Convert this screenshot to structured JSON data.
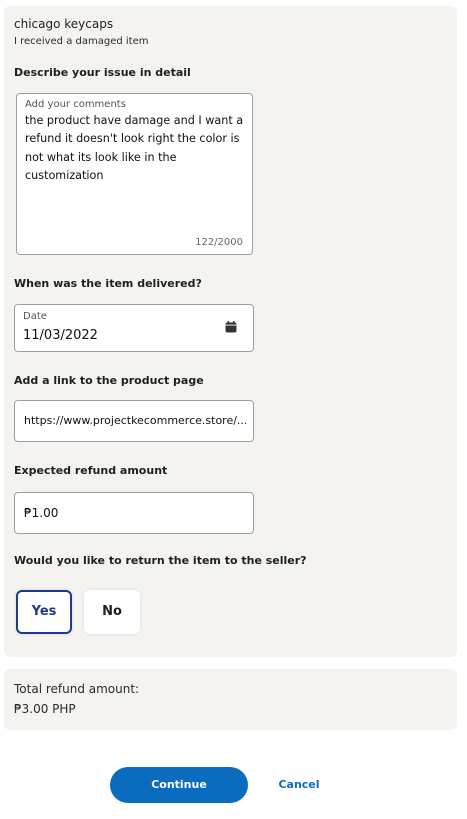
{
  "header": {
    "merchant": "chicago keycaps",
    "reason": "I received a damaged item"
  },
  "issue": {
    "label": "Describe your issue in detail",
    "placeholder": "Add your comments",
    "value": "the product have damage and I want a refund it doesn't look right the color is not what its look like in the customization",
    "counter": "122/2000"
  },
  "delivery": {
    "label": "When was the item delivered?",
    "field_label": "Date",
    "value": "11/03/2022",
    "icon": "calendar-icon"
  },
  "product_link": {
    "label": "Add a link to the product page",
    "value": "https://www.projectkecommerce.store/..."
  },
  "refund": {
    "label": "Expected refund amount",
    "value": "₱1.00"
  },
  "return_item": {
    "label": "Would you like to return the item to the seller?",
    "options": [
      "Yes",
      "No"
    ],
    "selected": "Yes"
  },
  "summary": {
    "label": "Total refund amount:",
    "value": "₱3.00 PHP"
  },
  "actions": {
    "continue": "Continue",
    "cancel": "Cancel"
  },
  "colors": {
    "primary": "#0a6cbf",
    "selected_border": "#1e3a8a",
    "panel_bg": "#f5f3ef"
  }
}
